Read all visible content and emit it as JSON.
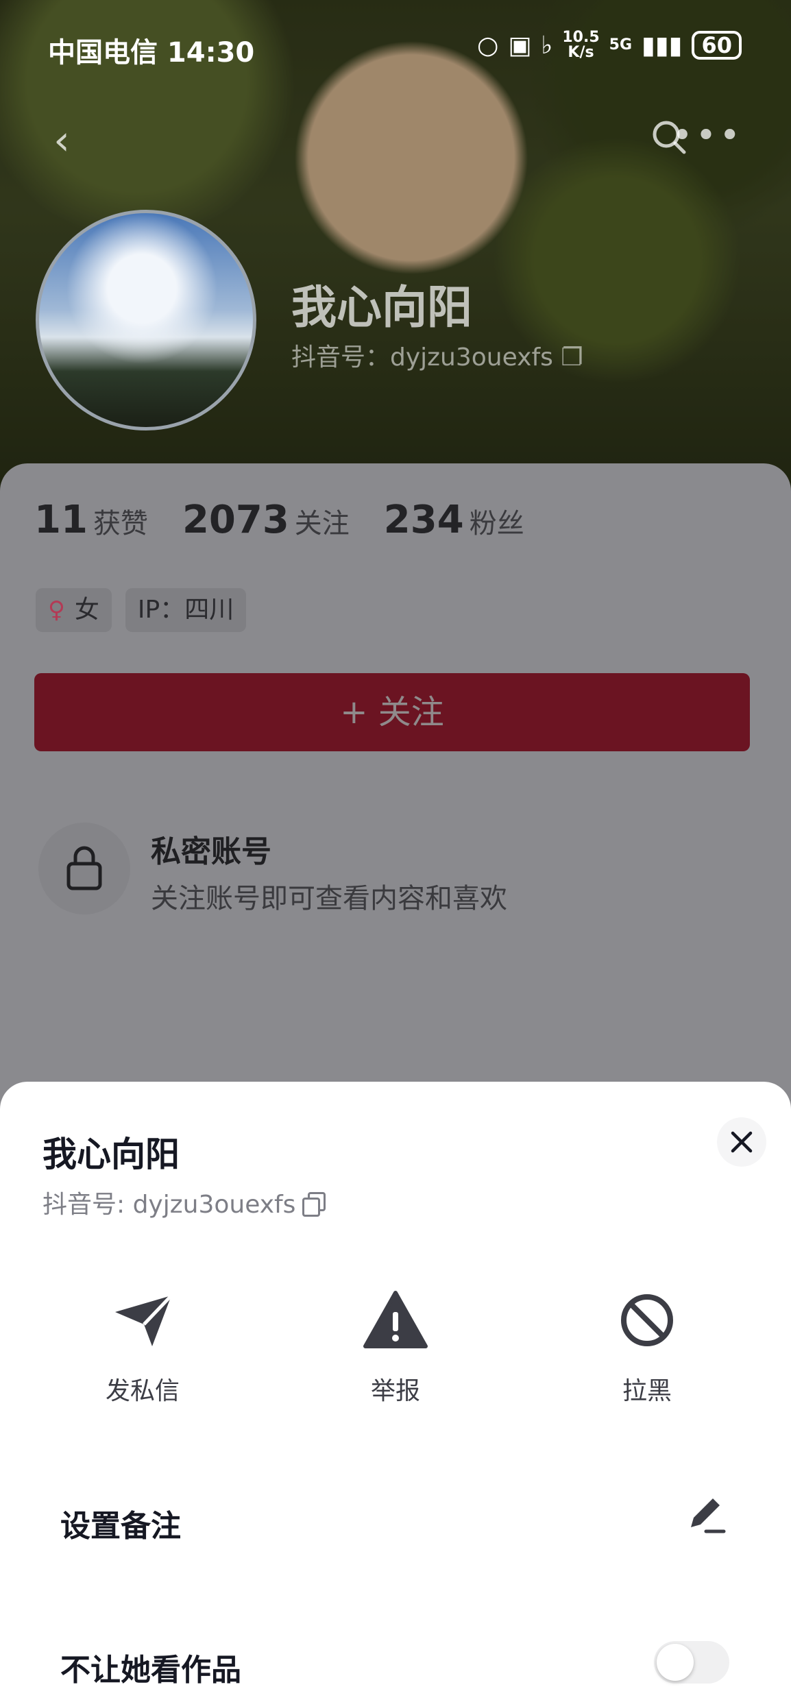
{
  "status_bar": {
    "carrier_time": "中国电信 14:30",
    "net_speed_value": "10.5",
    "net_speed_unit": "K/s",
    "network": "5G",
    "battery": "60"
  },
  "profile": {
    "name": "我心向阳",
    "douyin_id": "抖音号：dyjzu3ouexfs",
    "stats": [
      {
        "value": "11",
        "label": "获赞"
      },
      {
        "value": "2073",
        "label": "关注"
      },
      {
        "value": "234",
        "label": "粉丝"
      }
    ],
    "tags": {
      "gender": "女",
      "ip": "IP：四川"
    },
    "follow_label": "+ 关注",
    "private_title": "私密账号",
    "private_sub": "关注账号即可查看内容和喜欢"
  },
  "sheet": {
    "name": "我心向阳",
    "douyin_id": "抖音号: dyjzu3ouexfs",
    "actions": [
      {
        "label": "发私信",
        "icon": "send-icon"
      },
      {
        "label": "举报",
        "icon": "warning-icon"
      },
      {
        "label": "拉黑",
        "icon": "block-icon"
      }
    ],
    "rows": [
      {
        "label": "设置备注",
        "icon": "edit-icon"
      },
      {
        "label": "不让她看作品",
        "toggle_on": false
      }
    ]
  },
  "colors": {
    "follow_button": "#6b1422",
    "sheet_bg": "#ffffff",
    "text_primary": "#161823",
    "text_secondary": "#7d7e86"
  }
}
